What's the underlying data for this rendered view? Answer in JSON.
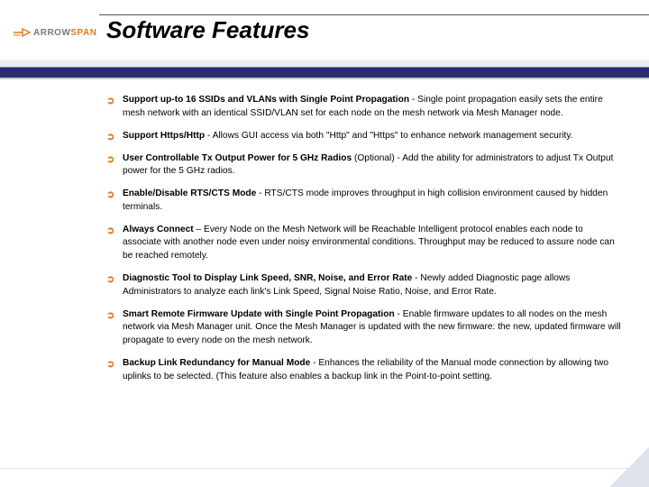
{
  "logo": {
    "part1": "ARROW",
    "part2": "SPAN"
  },
  "title": "Software Features",
  "bullet_glyph": "➲",
  "features": [
    {
      "lead": "Support up-to 16 SSIDs and VLANs with Single Point Propagation",
      "sep": " -  ",
      "rest": "Single point propagation easily sets the entire mesh network with an identical SSID/VLAN set for each node on the mesh network via Mesh Manager node."
    },
    {
      "lead": "Support Https/Http",
      "sep": " - ",
      "rest": "Allows GUI access via both \"Http\" and \"Https\" to enhance network management security."
    },
    {
      "lead": "User Controllable Tx Output Power for 5 GHz Radios",
      "sep": " (Optional) - ",
      "rest": "Add the ability for administrators to adjust Tx Output power for the 5 GHz radios."
    },
    {
      "lead": "Enable/Disable RTS/CTS Mode",
      "sep": " - ",
      "rest": "RTS/CTS mode improves throughput in high collision environment caused by hidden terminals."
    },
    {
      "lead": "Always Connect",
      "sep": " – ",
      "rest": "Every Node on the Mesh Network will be Reachable Intelligent protocol enables each node to associate with another node even under noisy environmental conditions. Throughput may be reduced to assure node can be reached remotely."
    },
    {
      "lead": "Diagnostic Tool to Display Link Speed, SNR, Noise,  and Error Rate",
      "sep": " - ",
      "rest": "Newly added Diagnostic page allows Administrators to analyze each link's Link Speed, Signal Noise Ratio, Noise, and Error Rate."
    },
    {
      "lead": "Smart Remote Firmware Update with Single Point Propagation",
      "sep": " - ",
      "rest": "Enable firmware updates to all nodes on the mesh network via Mesh Manager unit. Once the Mesh Manager is updated with the new firmware: the new, updated firmware will propagate to every node on the mesh network."
    },
    {
      "lead": "Backup Link Redundancy for Manual Mode",
      "sep": " - ",
      "rest": "Enhances the reliability of the Manual mode connection by allowing two uplinks to be selected. (This feature also enables a backup link in the Point-to-point setting."
    }
  ]
}
